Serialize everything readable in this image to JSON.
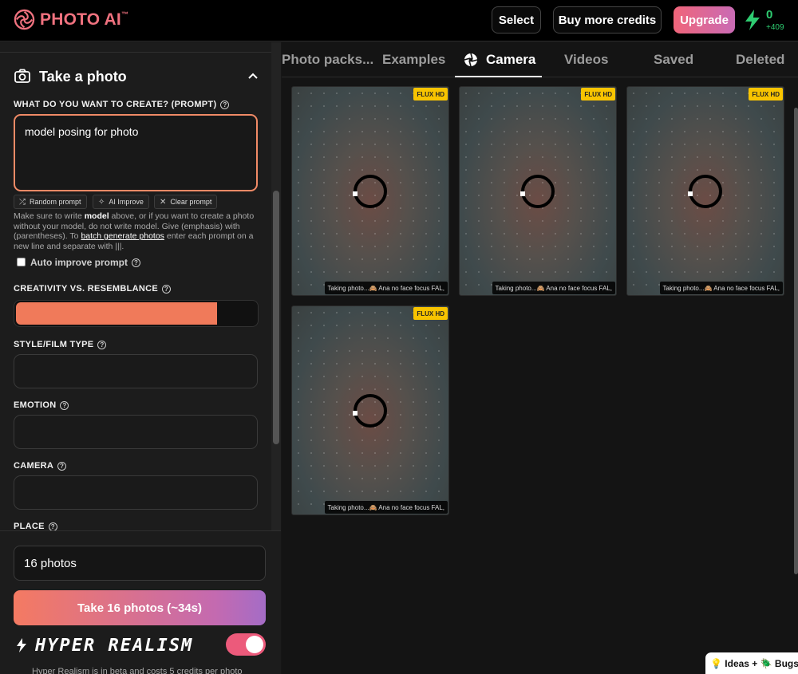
{
  "header": {
    "logo_text": "PHOTO AI",
    "logo_tm": "™",
    "select_label": "Select",
    "buy_credits_label": "Buy more credits",
    "upgrade_label": "Upgrade",
    "credits": "0",
    "credits_delta": "+409"
  },
  "sidebar": {
    "section_title": "Take a photo",
    "prompt_label": "WHAT DO YOU WANT TO CREATE? (PROMPT)",
    "prompt_value": "model posing for photo",
    "buttons": {
      "random": "Random prompt",
      "improve": "AI Improve",
      "clear": "Clear prompt"
    },
    "help": {
      "p1": "Make sure to write ",
      "b1": "model",
      "p2": " above, or if you want to create a photo without your model, do not write model. Give (emphasis) with (parentheses). To ",
      "link": "batch generate photos",
      "p3": " enter each prompt on a new line and separate with |||."
    },
    "auto_improve_label": "Auto improve prompt",
    "creativity_label": "CREATIVITY VS. RESEMBLANCE",
    "creativity_value": 0.82,
    "style_label": "STYLE/FILM TYPE",
    "emotion_label": "EMOTION",
    "camera_label": "CAMERA",
    "place_label": "PLACE",
    "photos_count": "16 photos",
    "take_button": "Take 16 photos (~34s)",
    "hyper_realism_label": "HYPER REALISM",
    "hyper_realism_on": true,
    "hyper_realism_note": "Hyper Realism is in beta and costs 5 credits per photo"
  },
  "tabs": [
    {
      "label": "Photo packs..."
    },
    {
      "label": "Examples"
    },
    {
      "label": "Camera"
    },
    {
      "label": "Videos"
    },
    {
      "label": "Saved"
    },
    {
      "label": "Deleted"
    }
  ],
  "active_tab": "Camera",
  "photos": [
    {
      "badge": "FLUX HD",
      "caption": "Taking photo...🙈 Ana no face focus FAL,"
    },
    {
      "badge": "FLUX HD",
      "caption": "Taking photo...🙈 Ana no face focus FAL,"
    },
    {
      "badge": "FLUX HD",
      "caption": "Taking photo...🙈 Ana no face focus FAL,"
    },
    {
      "badge": "FLUX HD",
      "caption": "Taking photo...🙈 Ana no face focus FAL,"
    }
  ],
  "feedback": "💡 Ideas + 🪲 Bugs",
  "colors": {
    "accent": "#f07a5a",
    "brand": "#f0727f",
    "credits_green": "#2ecc71",
    "badge_yellow": "#f8c400"
  }
}
